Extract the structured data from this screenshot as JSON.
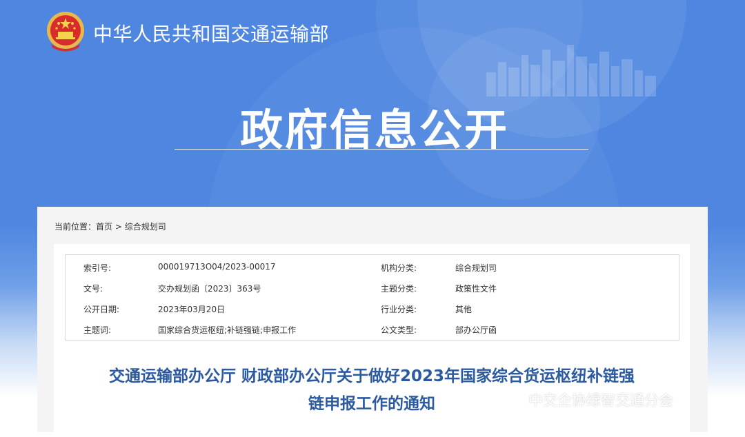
{
  "header": {
    "ministry_name": "中华人民共和国交通运输部",
    "banner_title": "政府信息公开"
  },
  "breadcrumb": {
    "label": "当前位置：",
    "home": "首页",
    "separator": " > ",
    "current": "综合规划司"
  },
  "meta": [
    {
      "k1": "索引号:",
      "v1": "000019713O04/2023-00017",
      "k2": "机构分类:",
      "v2": "综合规划司"
    },
    {
      "k1": "文号:",
      "v1": "交办规划函〔2023〕363号",
      "k2": "主题分类:",
      "v2": "政策性文件"
    },
    {
      "k1": "公开日期:",
      "v1": "2023年03月20日",
      "k2": "行业分类:",
      "v2": "其他"
    },
    {
      "k1": "主题词:",
      "v1": "国家综合货运枢纽;补链强链;申报工作",
      "k2": "公文类型:",
      "v2": "部办公厅函"
    }
  ],
  "document": {
    "title_line1": "交通运输部办公厅 财政部办公厅关于做好2023年国家综合货运枢纽补链强",
    "title_line2": "链申报工作的通知"
  },
  "watermark": {
    "icon": "wechat-icon",
    "text": "中交企协绿智交通分会"
  },
  "colors": {
    "banner_blue": "#4f87e0",
    "title_blue": "#2c5aa0",
    "panel_gray": "#f4f4f4"
  }
}
